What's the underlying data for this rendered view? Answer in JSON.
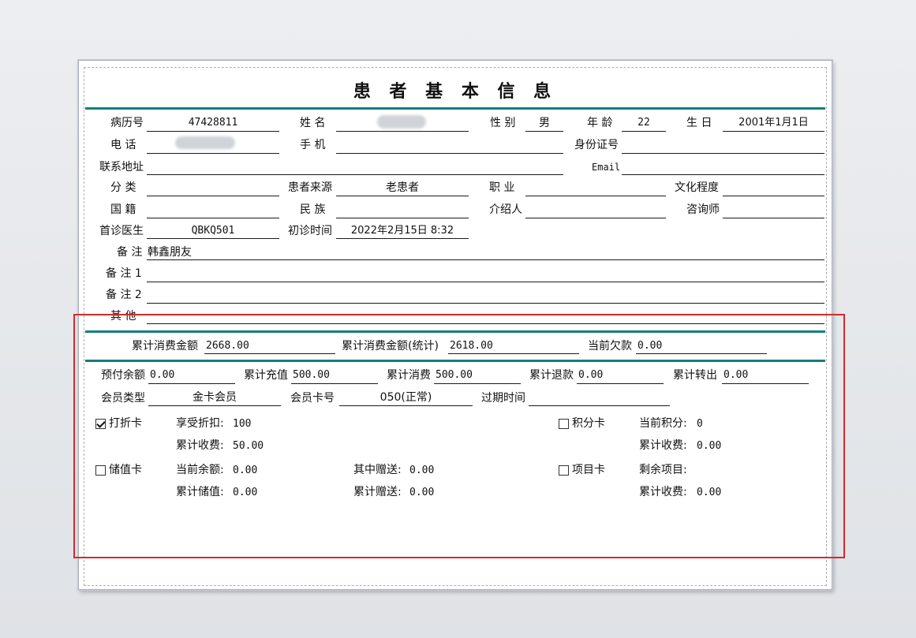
{
  "title": "患 者 基 本 信 息",
  "colors": {
    "accent": "#167e7e",
    "highlight": "#d42a2a"
  },
  "basic": {
    "record_no_label": "病历号",
    "record_no": "47428811",
    "name_label": "姓  名",
    "name": "",
    "gender_label": "性  别",
    "gender": "男",
    "age_label": "年  龄",
    "age": "22",
    "birthday_label": "生  日",
    "birthday": "2001年1月1日",
    "phone_label": "电  话",
    "phone": "",
    "mobile_label": "手  机",
    "mobile": "",
    "id_label": "身份证号",
    "id_no": "",
    "address_label": "联系地址",
    "address": "",
    "email_label": "Email",
    "email": "",
    "category_label": "分  类",
    "category": "",
    "source_label": "患者来源",
    "source": "老患者",
    "job_label": "职  业",
    "job": "",
    "edu_label": "文化程度",
    "edu": "",
    "nationality_label": "国  籍",
    "nationality": "",
    "ethnic_label": "民  族",
    "ethnic": "",
    "referrer_label": "介绍人",
    "referrer": "",
    "consultant_label": "咨询师",
    "consultant": "",
    "first_doctor_label": "首诊医生",
    "first_doctor": "QBKQ501",
    "first_visit_label": "初诊时间",
    "first_visit": "2022年2月15日 8:32",
    "note_label": "备 注",
    "note": "韩鑫朋友",
    "note1_label": "备 注 1",
    "note1": "",
    "note2_label": "备 注 2",
    "note2": "",
    "other_label": "其  他",
    "other": ""
  },
  "summary": {
    "total_spend_label": "累计消费金额",
    "total_spend": "2668.00",
    "total_spend_stat_label": "累计消费金额(统计)",
    "total_spend_stat": "2618.00",
    "debt_label": "当前欠款",
    "debt": "0.00"
  },
  "account": {
    "prepaid_label": "预付余额",
    "prepaid": "0.00",
    "recharge_label": "累计充值",
    "recharge": "500.00",
    "consume_label": "累计消费",
    "consume": "500.00",
    "refund_label": "累计退款",
    "refund": "0.00",
    "transfer_label": "累计转出",
    "transfer": "0.00",
    "member_type_label": "会员类型",
    "member_type": "金卡会员",
    "card_no_label": "会员卡号",
    "card_no": "050(正常)",
    "expire_label": "过期时间",
    "expire": ""
  },
  "cards": {
    "discount": {
      "label": "打折卡",
      "checked": true,
      "rate_label": "享受折扣:",
      "rate": "100",
      "fee_label": "累计收费:",
      "fee": "50.00"
    },
    "points": {
      "label": "积分卡",
      "checked": false,
      "current_label": "当前积分:",
      "current": "0",
      "fee_label": "累计收费:",
      "fee": "0.00"
    },
    "stored": {
      "label": "储值卡",
      "checked": false,
      "balance_label": "当前余额:",
      "balance": "0.00",
      "total_label": "累计储值:",
      "total": "0.00",
      "gift_label": "其中赠送:",
      "gift": "0.00",
      "gift_total_label": "累计赠送:",
      "gift_total": "0.00"
    },
    "project": {
      "label": "项目卡",
      "checked": false,
      "remaining_label": "剩余项目:",
      "remaining": "",
      "fee_label": "累计收费:",
      "fee": "0.00"
    }
  }
}
